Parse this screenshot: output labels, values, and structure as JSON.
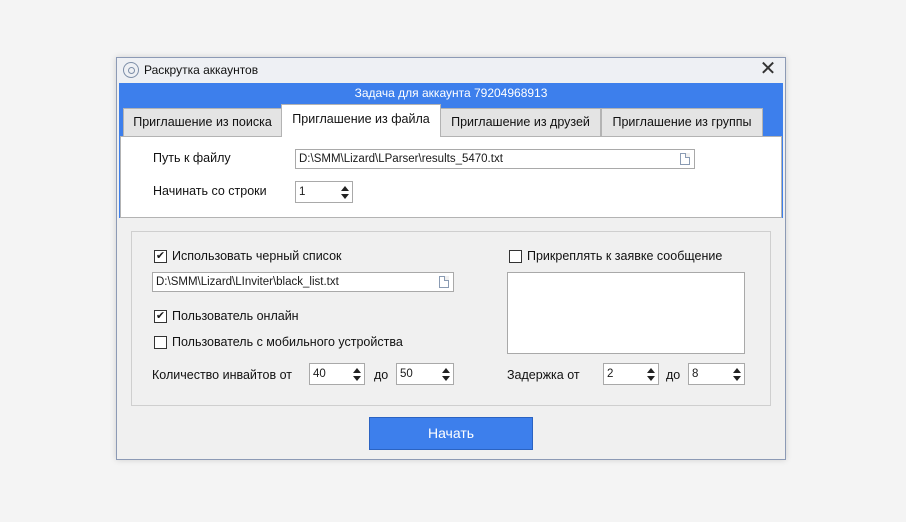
{
  "window": {
    "title": "Раскрутка аккаунтов",
    "close_glyph": "✕",
    "task_header": "Задача для аккаунта 79204968913"
  },
  "tabs": [
    {
      "label": "Приглашение из поиска",
      "active": false
    },
    {
      "label": "Приглашение из файла",
      "active": true
    },
    {
      "label": "Приглашение из друзей",
      "active": false
    },
    {
      "label": "Приглашение из группы",
      "active": false
    }
  ],
  "file_tab": {
    "path_label": "Путь к файлу",
    "path_value": "D:\\SMM\\Lizard\\LParser\\results_5470.txt",
    "start_row_label": "Начинать со строки",
    "start_row_value": "1"
  },
  "options": {
    "blacklist_label": "Использовать черный список",
    "blacklist_checked": true,
    "blacklist_path": "D:\\SMM\\Lizard\\LInviter\\black_list.txt",
    "online_label": "Пользователь онлайн",
    "online_checked": true,
    "mobile_label": "Пользователь с мобильного устройства",
    "mobile_checked": false,
    "invites_from_label": "Количество инвайтов от",
    "invites_from_value": "40",
    "invites_to_label": "до",
    "invites_to_value": "50",
    "attach_label": "Прикреплять к заявке сообщение",
    "attach_checked": false,
    "message_value": "",
    "delay_from_label": "Задержка от",
    "delay_from_value": "2",
    "delay_to_label": "до",
    "delay_to_value": "8"
  },
  "actions": {
    "start_label": "Начать"
  },
  "colors": {
    "accent": "#3d7fec",
    "window_bg": "#f0f0f0"
  },
  "icons": {
    "app": "settings-gear-icon",
    "file": "file-icon",
    "check": "✔"
  }
}
